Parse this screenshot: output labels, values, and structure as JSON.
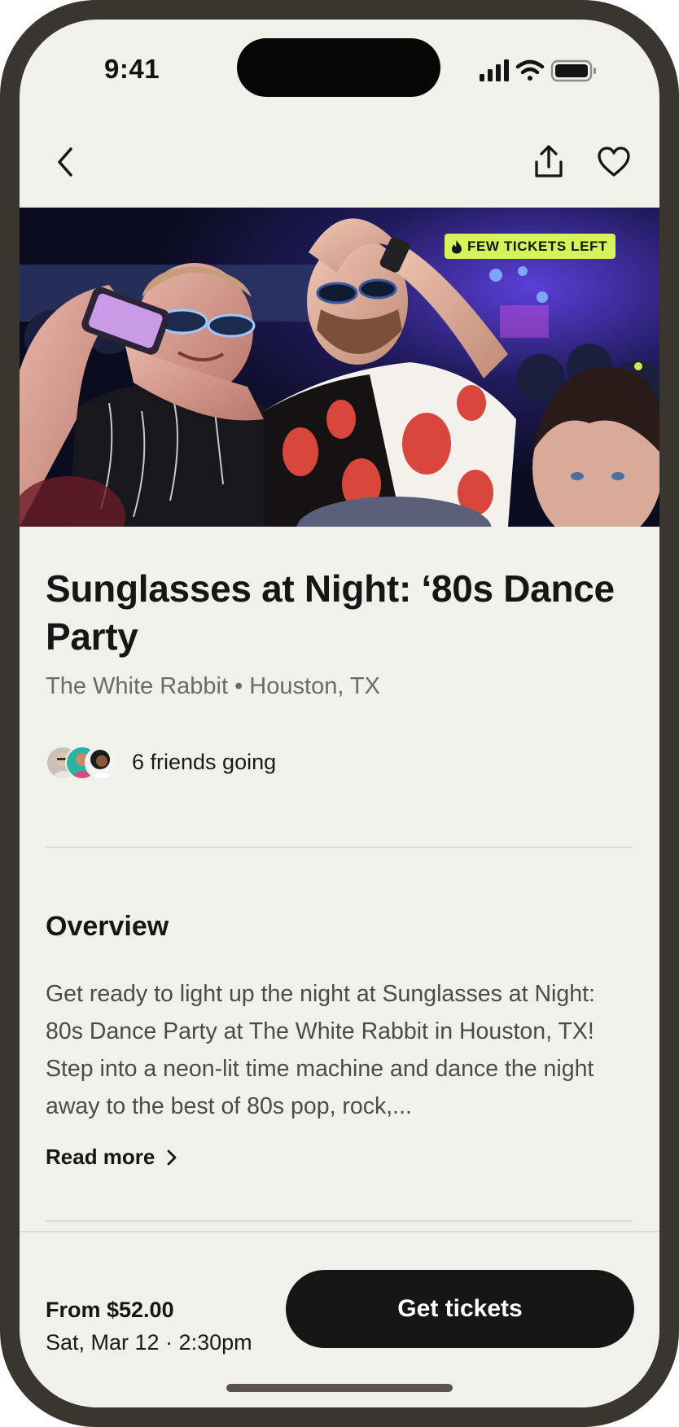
{
  "status_bar": {
    "time": "9:41"
  },
  "nav": {
    "back_icon": "chevron-left-icon",
    "share_icon": "share-icon",
    "favorite_icon": "heart-icon"
  },
  "hero": {
    "badge_label": "FEW TICKETS LEFT",
    "badge_icon": "flame-icon",
    "badge_color": "#d6f35a"
  },
  "event": {
    "title": "Sunglasses at Night: ‘80s Dance Party",
    "subtitle": "The White Rabbit • Houston, TX",
    "friends_label": "6 friends going"
  },
  "overview": {
    "heading": "Overview",
    "text": "Get ready to light up the night at Sunglasses at Night: 80s Dance Party at The White Rabbit in Houston, TX! Step into a neon-lit time machine and dance the night away to the best of 80s pop, rock,...",
    "read_more_label": "Read more"
  },
  "footer": {
    "price": "From $52.00",
    "date": "Sat, Mar 12 · 2:30pm",
    "cta_label": "Get tickets"
  },
  "colors": {
    "background": "#f1f1ec",
    "frame": "#3b3530",
    "primary": "#161616",
    "accent": "#d6f35a"
  }
}
